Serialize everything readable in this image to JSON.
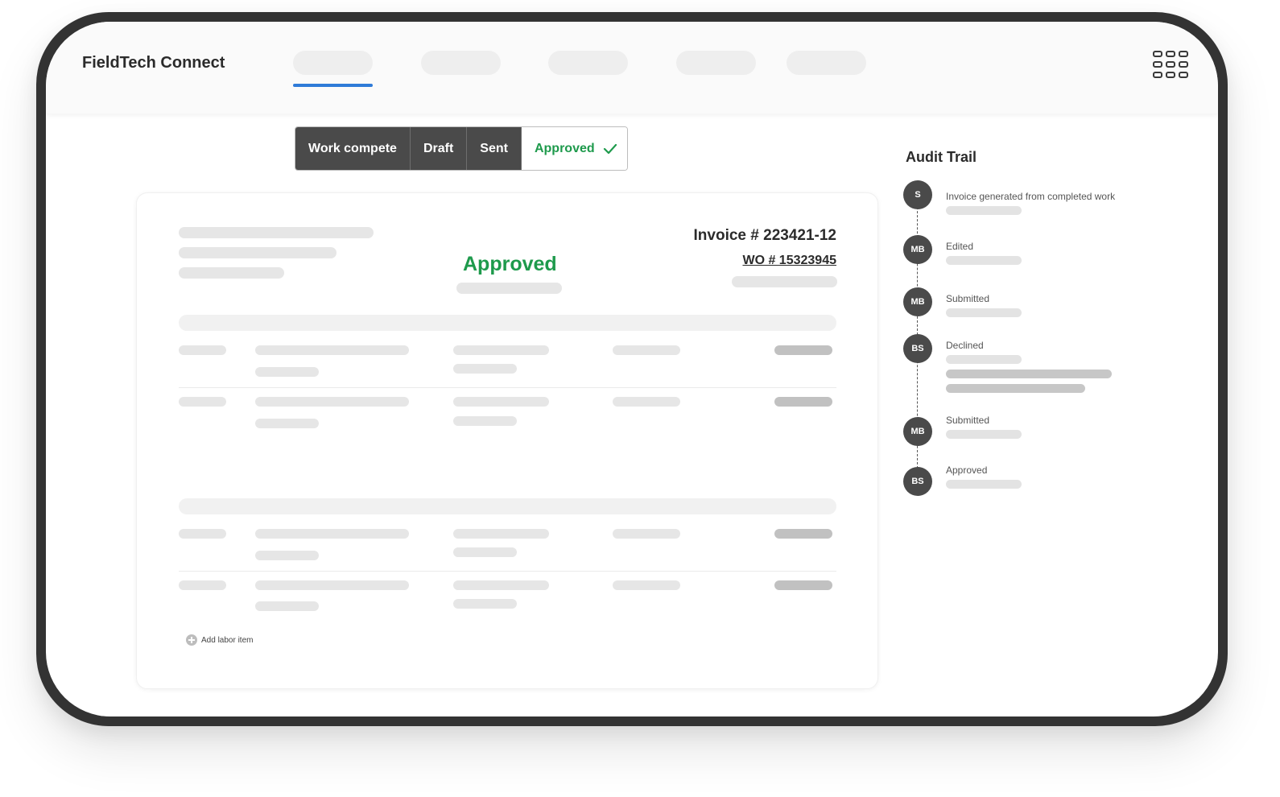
{
  "app": {
    "title": "FieldTech Connect"
  },
  "header": {
    "apps_icon": "grid-apps-icon"
  },
  "status_bar": {
    "steps": [
      "Work compete",
      "Draft",
      "Sent"
    ],
    "current": "Approved",
    "current_icon": "check-icon",
    "accent_color": "#1e9a4c"
  },
  "invoice": {
    "status": "Approved",
    "invoice_number": "Invoice # 223421-12",
    "work_order": "WO # 15323945",
    "add_labor_label": "Add labor item"
  },
  "audit": {
    "title": "Audit Trail",
    "entries": [
      {
        "initials": "S",
        "label": "Invoice generated from completed work"
      },
      {
        "initials": "MB",
        "label": "Edited"
      },
      {
        "initials": "MB",
        "label": "Submitted"
      },
      {
        "initials": "BS",
        "label": "Declined"
      },
      {
        "initials": "MB",
        "label": "Submitted"
      },
      {
        "initials": "BS",
        "label": "Approved"
      }
    ]
  }
}
